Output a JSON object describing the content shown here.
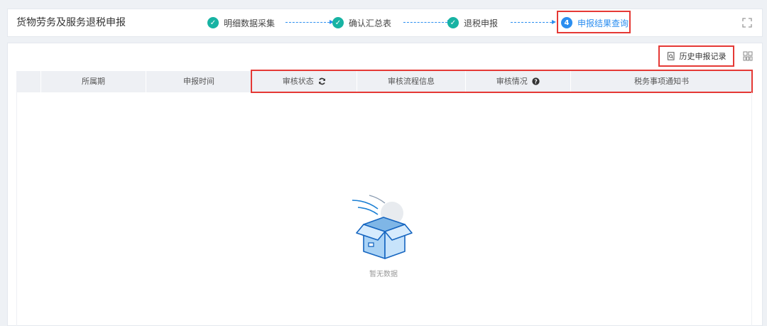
{
  "header": {
    "title": "货物劳务及服务退税申报",
    "steps": [
      {
        "label": "明细数据采集",
        "status": "done"
      },
      {
        "label": "确认汇总表",
        "status": "done"
      },
      {
        "label": "退税申报",
        "status": "done"
      },
      {
        "label": "申报结果查询",
        "status": "active",
        "number": "4"
      }
    ]
  },
  "toolbar": {
    "history_label": "历史申报记录"
  },
  "table": {
    "columns": [
      "所属期",
      "申报时间",
      "审核状态",
      "审核流程信息",
      "审核情况",
      "税务事项通知书"
    ],
    "rows": []
  },
  "empty_state": {
    "text": "暂无数据"
  },
  "colors": {
    "done": "#17b3a3",
    "active": "#2b8ef0",
    "highlight": "#e53935"
  }
}
